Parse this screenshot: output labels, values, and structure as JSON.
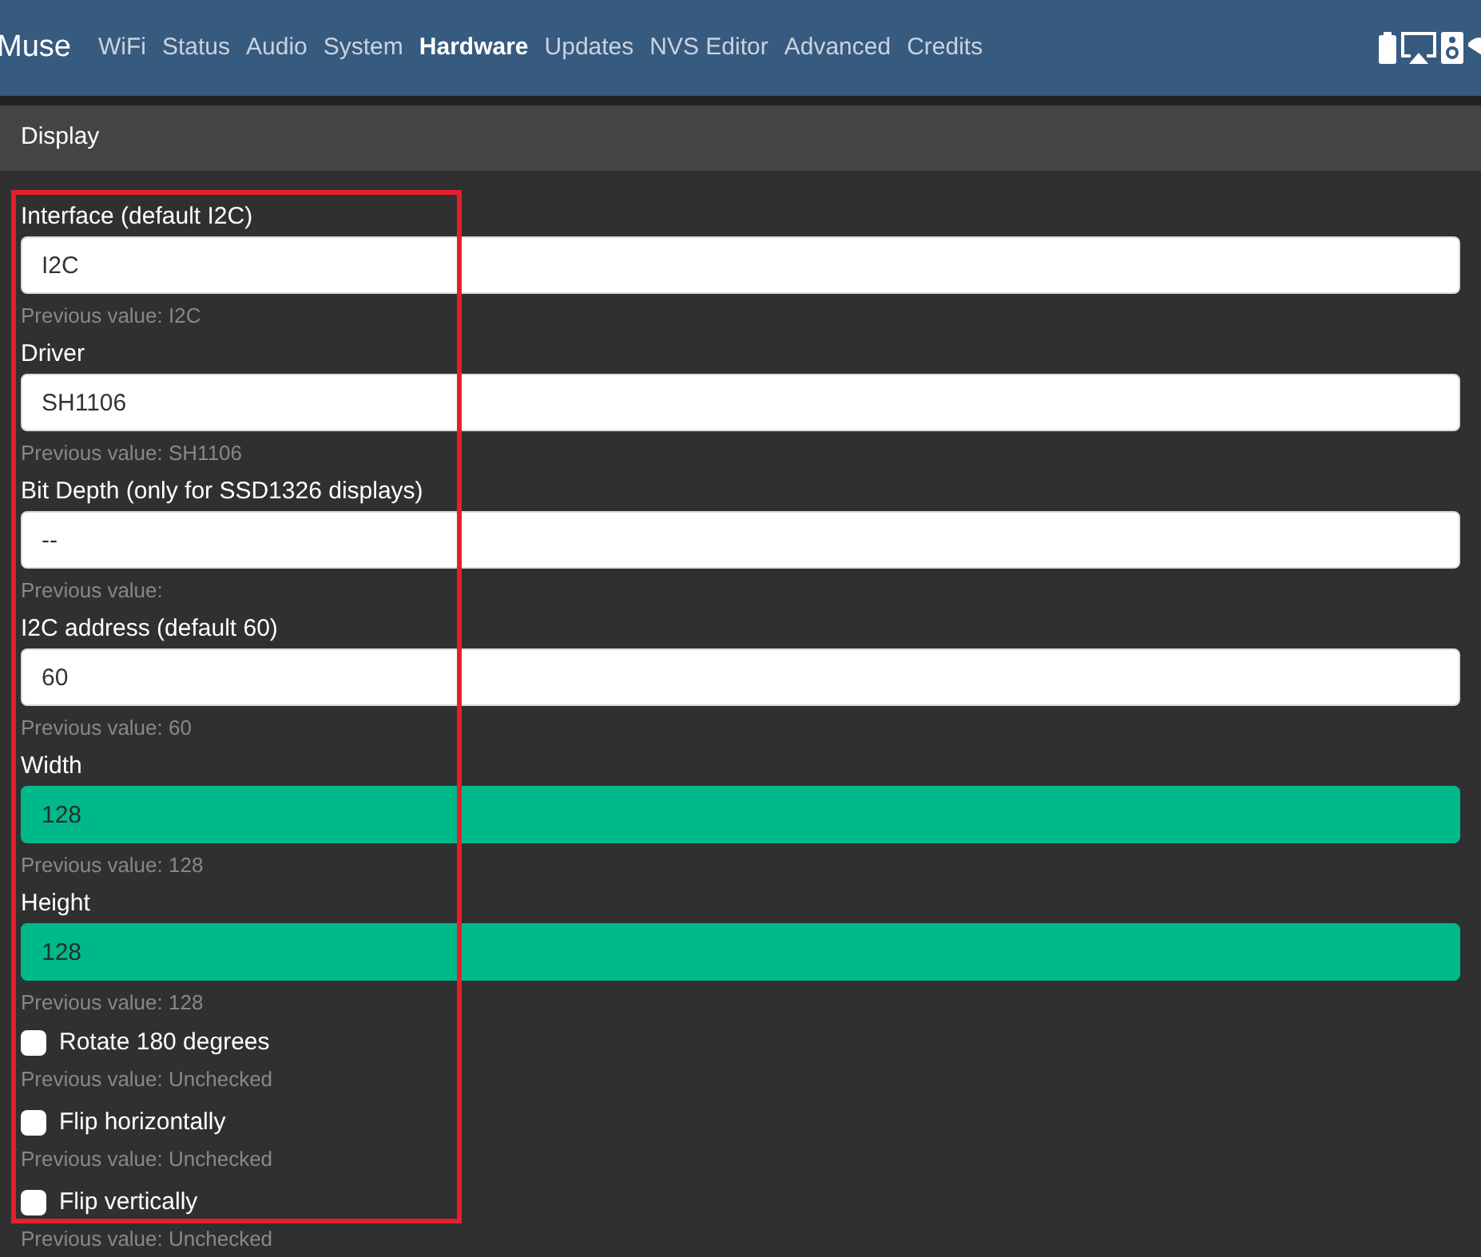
{
  "navbar": {
    "brand": "Muse",
    "tabs": [
      {
        "label": "WiFi",
        "selected": false
      },
      {
        "label": "Status",
        "selected": false
      },
      {
        "label": "Audio",
        "selected": false
      },
      {
        "label": "System",
        "selected": false
      },
      {
        "label": "Hardware",
        "selected": true
      },
      {
        "label": "Updates",
        "selected": false
      },
      {
        "label": "NVS Editor",
        "selected": false
      },
      {
        "label": "Advanced",
        "selected": false
      },
      {
        "label": "Credits",
        "selected": false
      }
    ]
  },
  "section": {
    "title": "Display"
  },
  "fields": [
    {
      "kind": "text",
      "label": "Interface (default I2C)",
      "value": "I2C",
      "changed": false,
      "hint": "Previous value: I2C"
    },
    {
      "kind": "text",
      "label": "Driver",
      "value": "SH1106",
      "changed": false,
      "hint": "Previous value: SH1106"
    },
    {
      "kind": "text",
      "label": "Bit Depth (only for SSD1326 displays)",
      "value": "--",
      "changed": false,
      "hint": "Previous value:"
    },
    {
      "kind": "text",
      "label": "I2C address (default 60)",
      "value": "60",
      "changed": false,
      "hint": "Previous value: 60"
    },
    {
      "kind": "text",
      "label": "Width",
      "value": "128",
      "changed": true,
      "hint": "Previous value: 128"
    },
    {
      "kind": "text",
      "label": "Height",
      "value": "128",
      "changed": true,
      "hint": "Previous value: 128"
    },
    {
      "kind": "checkbox",
      "label": "Rotate 180 degrees",
      "checked": false,
      "hint": "Previous value: Unchecked"
    },
    {
      "kind": "checkbox",
      "label": "Flip horizontally",
      "checked": false,
      "hint": "Previous value: Unchecked"
    },
    {
      "kind": "checkbox",
      "label": "Flip vertically",
      "checked": false,
      "hint": "Previous value: Unchecked"
    }
  ]
}
